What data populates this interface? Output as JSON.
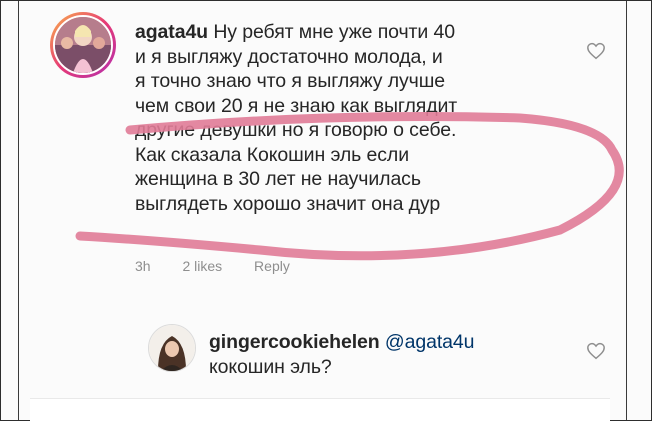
{
  "comment": {
    "username": "agata4u",
    "lines": [
      "Ну ребят мне уже почти 40",
      "и я выгляжу достаточно молода, и",
      "я точно знаю что я выгляжу лучше",
      "чем свои 20 я не знаю как выглядит",
      "другие девушки но я говорю о себе.",
      "Как сказала Кокошин эль если",
      "женщина в 30 лет не научилась",
      "выглядеть хорошо значит она дур"
    ],
    "time": "3h",
    "likes": "2 likes",
    "reply": "Reply",
    "heart_icon": "heart-outline-icon"
  },
  "reply": {
    "username": "gingercookiehelen",
    "mention": "@agata4u",
    "text": "кокошин эль?",
    "heart_icon": "heart-outline-icon"
  },
  "colors": {
    "text": "#262626",
    "meta": "#8e8e8e",
    "scribble": "#e07b97",
    "background": "#fbfbfb"
  }
}
